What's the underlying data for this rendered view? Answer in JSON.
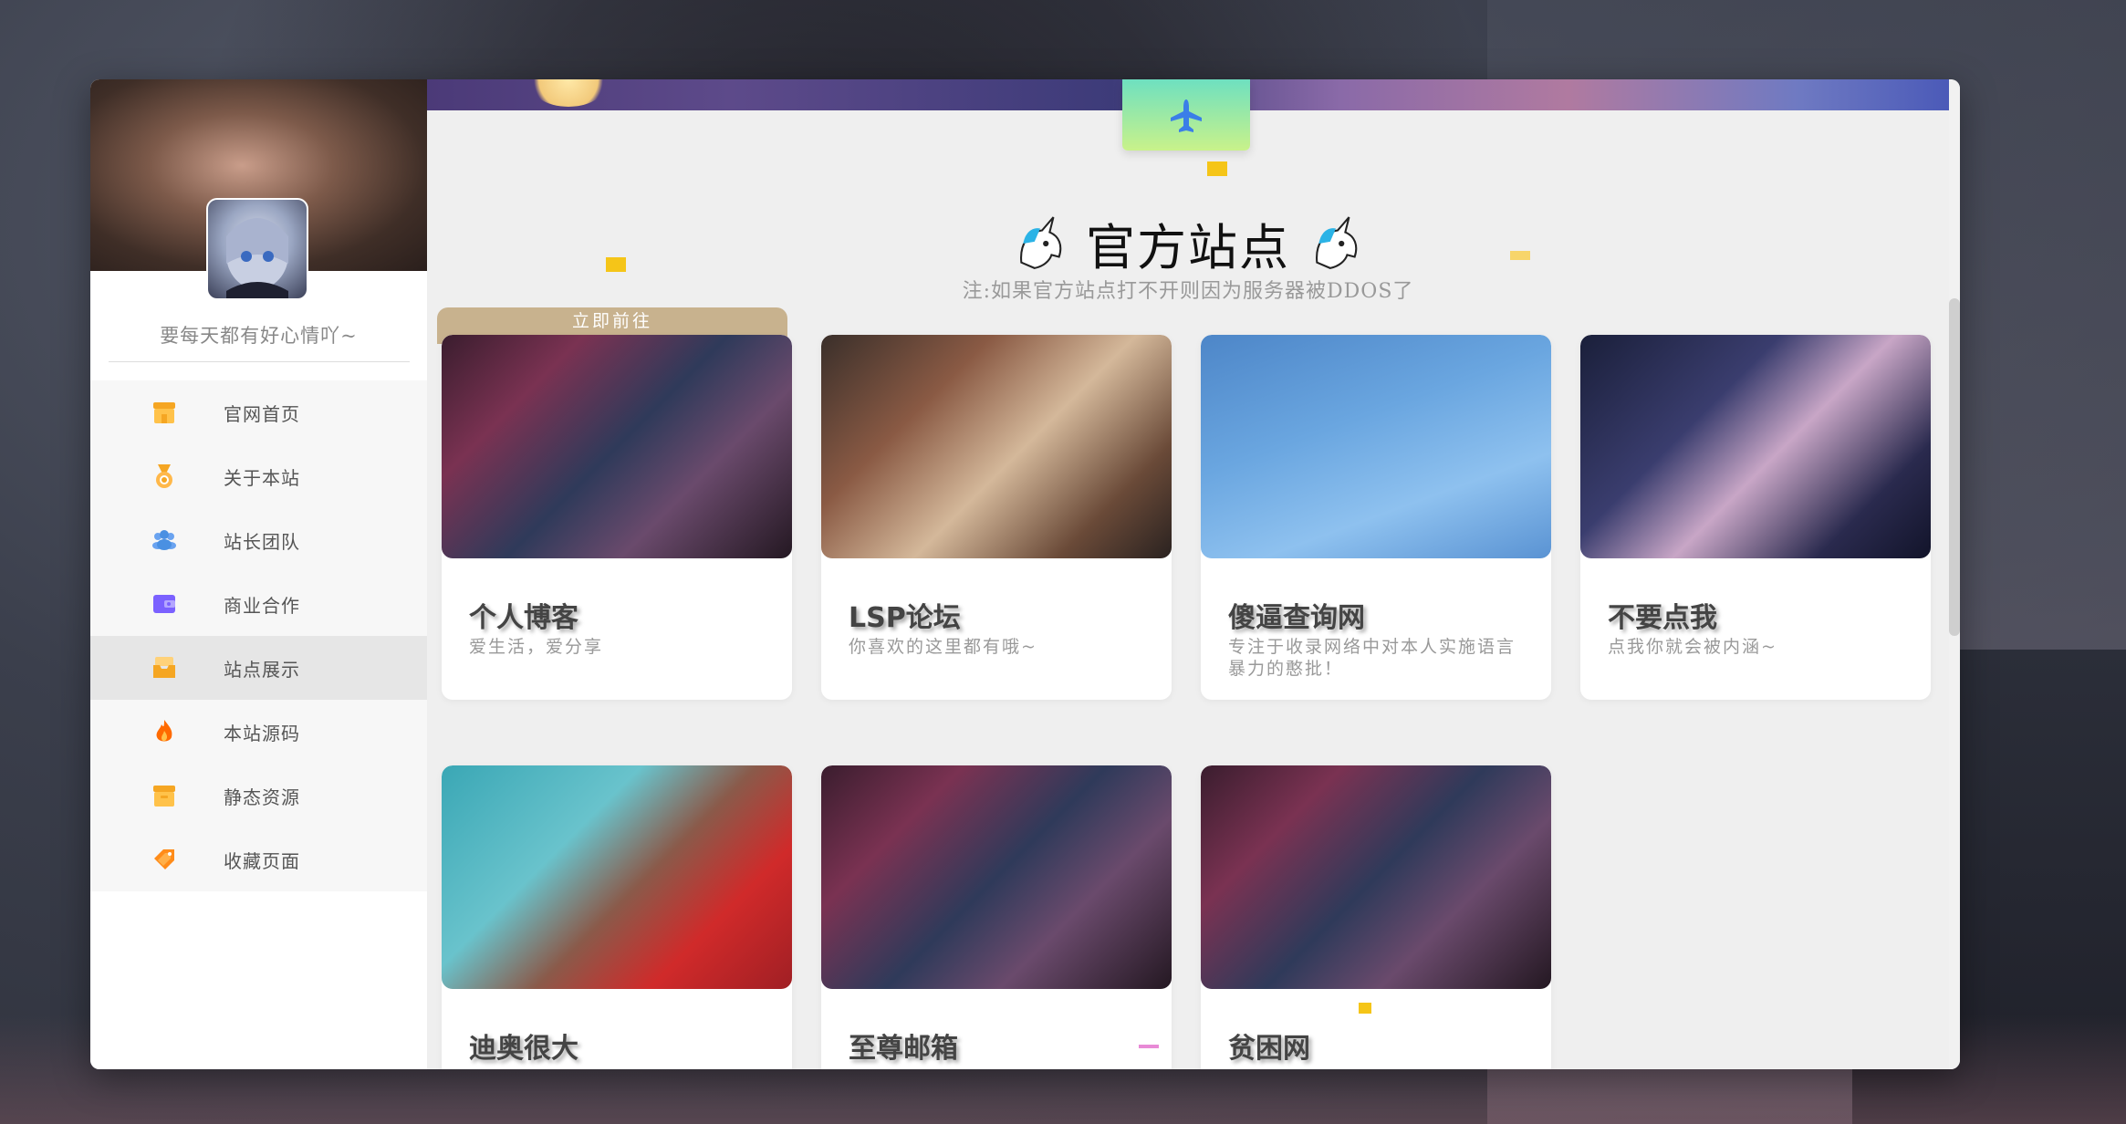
{
  "sidebar": {
    "motto": "要每天都有好心情吖~",
    "items": [
      {
        "label": "官网首页",
        "icon": "shop-icon",
        "color": "#f5a623"
      },
      {
        "label": "关于本站",
        "icon": "medal-icon",
        "color": "#f5a623"
      },
      {
        "label": "站长团队",
        "icon": "team-icon",
        "color": "#4a90e2"
      },
      {
        "label": "商业合作",
        "icon": "wallet-icon",
        "color": "#7b61ff"
      },
      {
        "label": "站点展示",
        "icon": "inbox-icon",
        "color": "#f5a623"
      },
      {
        "label": "本站源码",
        "icon": "fire-icon",
        "color": "#ff6a00"
      },
      {
        "label": "静态资源",
        "icon": "box-icon",
        "color": "#f5a623"
      },
      {
        "label": "收藏页面",
        "icon": "tag-icon",
        "color": "#ff8c1a"
      }
    ],
    "active_index": 4
  },
  "main": {
    "title": "官方站点",
    "note": "注:如果官方站点打不开则因为服务器被DDOS了",
    "go_label": "立即前往",
    "cards": [
      {
        "name": "个人博客",
        "desc": "爱生活，爱分享"
      },
      {
        "name": "LSP论坛",
        "desc": "你喜欢的这里都有哦~"
      },
      {
        "name": "傻逼查询网",
        "desc": "专注于收录网络中对本人实施语言暴力的憨批！"
      },
      {
        "name": "不要点我",
        "desc": "点我你就会被内涵~"
      },
      {
        "name": "迪奥很大",
        "desc": ""
      },
      {
        "name": "至尊邮箱",
        "desc": ""
      },
      {
        "name": "贫困网",
        "desc": ""
      }
    ]
  },
  "colors": {
    "accent_gold": "#c8b28e",
    "plane_button": "#8be8b0"
  }
}
